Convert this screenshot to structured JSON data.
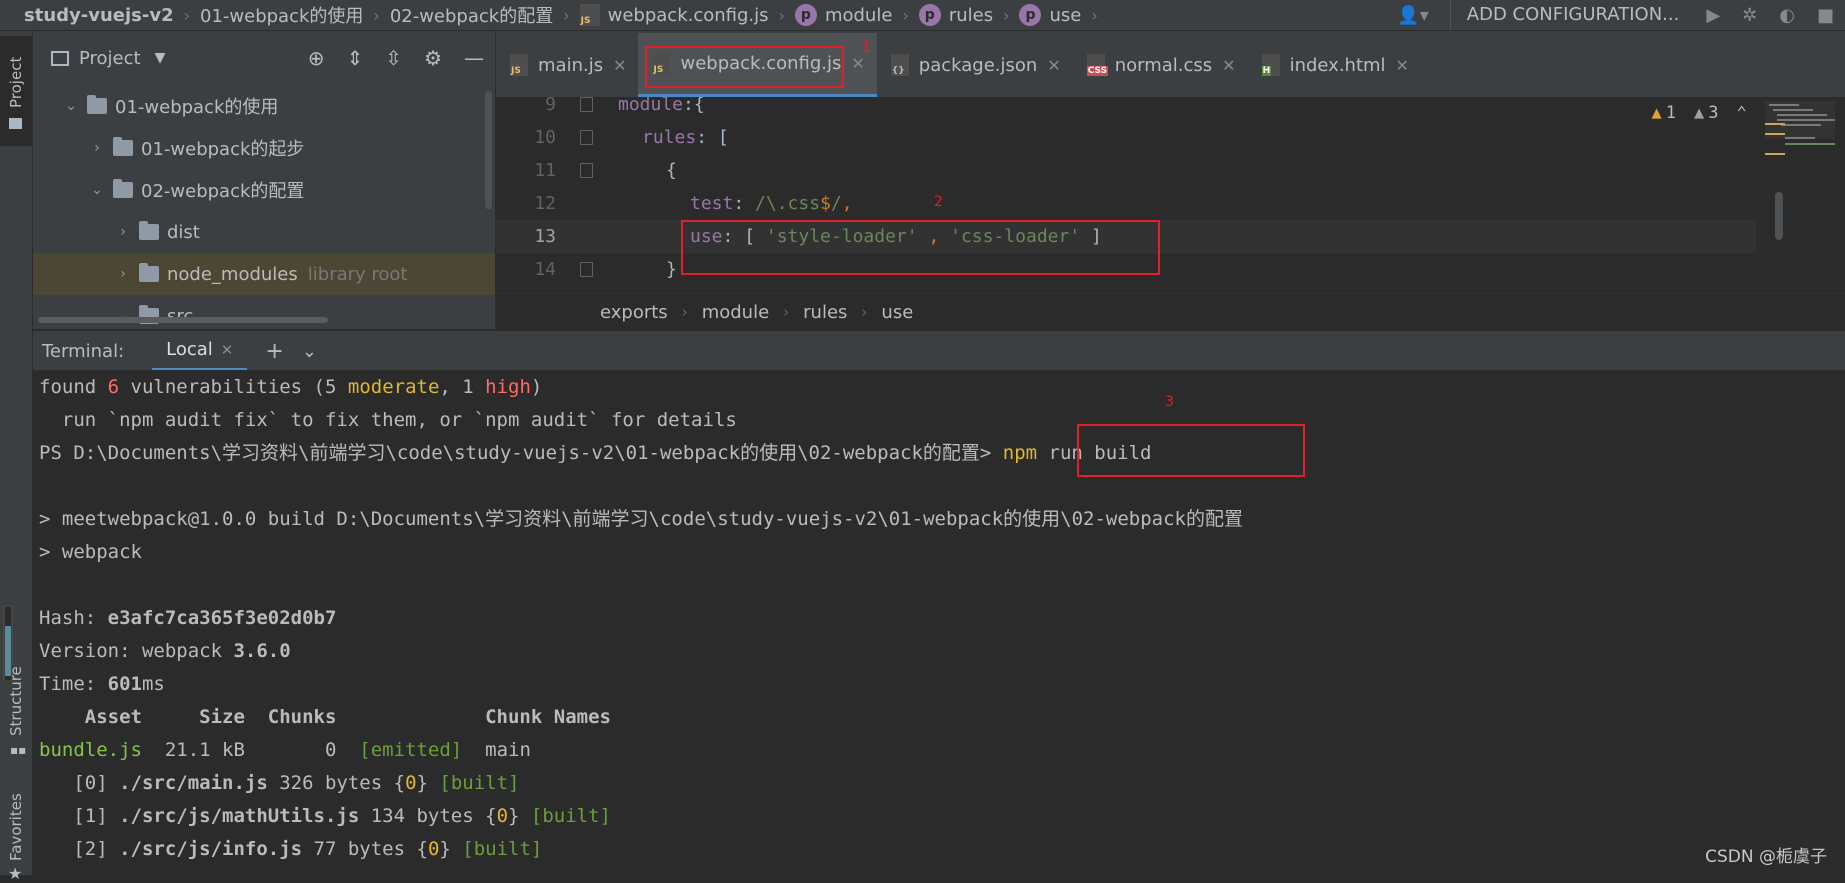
{
  "navbar": {
    "crumbs": [
      "study-vuejs-v2",
      "01-webpack的使用",
      "02-webpack的配置",
      "webpack.config.js",
      "module",
      "rules",
      "use"
    ],
    "add_configuration": "ADD CONFIGURATION..."
  },
  "left_strip": {
    "project_tab": "Project",
    "structure_tab": "Structure",
    "favorites_tab": "Favorites"
  },
  "project_panel": {
    "title": "Project",
    "tree": [
      {
        "label": "01-webpack的使用",
        "expanded": true
      },
      {
        "label": "01-webpack的起步",
        "expanded": false
      },
      {
        "label": "02-webpack的配置",
        "expanded": true
      },
      {
        "label": "dist",
        "expanded": false
      },
      {
        "label": "node_modules",
        "suffix": "library root",
        "expanded": false,
        "selected": true
      },
      {
        "label": "src",
        "expanded": true
      }
    ]
  },
  "editor_tabs": [
    {
      "label": "main.js",
      "icon": "JS"
    },
    {
      "label": "webpack.config.js",
      "icon": "JS",
      "active": true
    },
    {
      "label": "package.json",
      "icon": "{}"
    },
    {
      "label": "normal.css",
      "icon": "CSS"
    },
    {
      "label": "index.html",
      "icon": "H"
    }
  ],
  "editor": {
    "lines": [
      {
        "num": "9",
        "text": "module:{"
      },
      {
        "num": "10",
        "text": "rules: ["
      },
      {
        "num": "11",
        "text": "{"
      },
      {
        "num": "12",
        "text": "test: /\\.css$/,"
      },
      {
        "num": "13",
        "text": "use: [ 'style-loader' , 'css-loader' ]"
      },
      {
        "num": "14",
        "text": "}"
      }
    ],
    "warnings": "1",
    "weak_warnings": "3",
    "breadcrumbs": [
      "exports",
      "module",
      "rules",
      "use"
    ]
  },
  "terminal": {
    "label": "Terminal:",
    "tab": "Local",
    "lines": {
      "l1_a": "found ",
      "l1_b": "6",
      "l1_c": " vulnerabilities (5 ",
      "l1_d": "moderate",
      "l1_e": ", 1 ",
      "l1_f": "high",
      "l1_g": ")",
      "l2": "  run `npm audit fix` to fix them, or `npm audit` for details",
      "l3_prompt": "PS D:\\Documents\\学习资料\\前端学习\\code\\study-vuejs-v2\\01-webpack的使用\\02-webpack的配置> ",
      "l3_cmd": "npm",
      "l3_args": " run build",
      "l4": "> meetwebpack@1.0.0 build D:\\Documents\\学习资料\\前端学习\\code\\study-vuejs-v2\\01-webpack的使用\\02-webpack的配置",
      "l5": "> webpack",
      "hash_label": "Hash: ",
      "hash": "e3afc7ca365f3e02d0b7",
      "version_label": "Version: webpack ",
      "version": "3.6.0",
      "time_label": "Time: ",
      "time": "601",
      "time_unit": "ms",
      "table_header": "    Asset     Size  Chunks             Chunk Names",
      "asset": "bundle.js",
      "asset_size": "  21.1 kB       0  ",
      "asset_status": "[emitted]",
      "asset_chunk": "  main",
      "m0_idx": "   [0] ",
      "m0_path": "./src/main.js",
      "m0_size": " 326 bytes {",
      "m0_chunk": "0",
      "m0_close": "} ",
      "m0_status": "[built]",
      "m1_idx": "   [1] ",
      "m1_path": "./src/js/mathUtils.js",
      "m1_size": " 134 bytes {",
      "m1_chunk": "0",
      "m1_close": "} ",
      "m1_status": "[built]",
      "m2_idx": "   [2] ",
      "m2_path": "./src/js/info.js",
      "m2_size": " 77 bytes {",
      "m2_chunk": "0",
      "m2_close": "} ",
      "m2_status": "[built]"
    }
  },
  "annotations": [
    "1",
    "2",
    "3"
  ],
  "watermark": "CSDN @栀虞子"
}
